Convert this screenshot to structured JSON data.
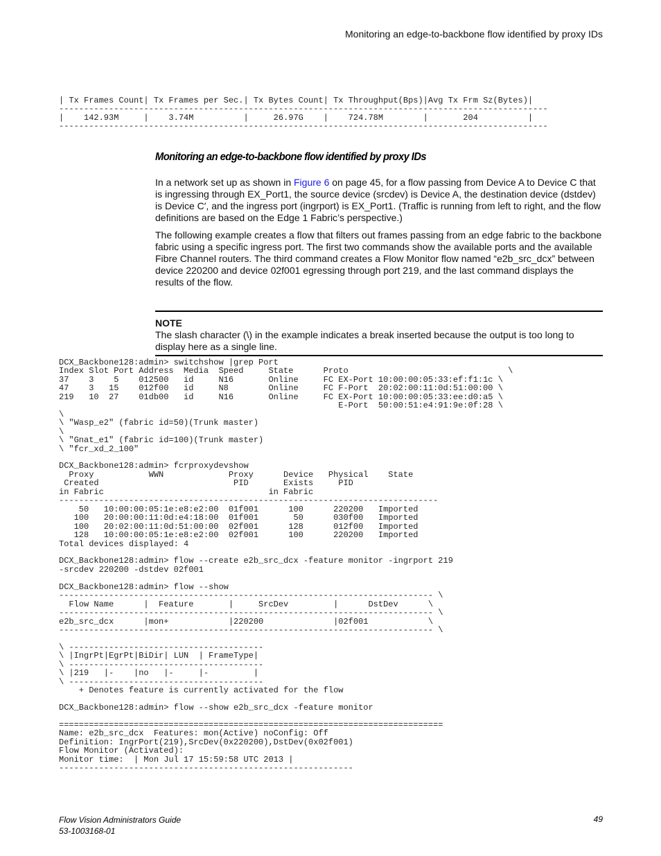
{
  "header": {
    "running_title": "Monitoring an edge-to-backbone flow identified by proxy IDs"
  },
  "stats_output": {
    "lines": [
      "| Tx Frames Count| Tx Frames per Sec.| Tx Bytes Count| Tx Throughput(Bps)|Avg Tx Frm Sz(Bytes)|",
      "--------------------------------------------------------------------------------------------------",
      "|    142.93M     |    3.74M          |     26.97G    |    724.78M        |       204          |",
      "--------------------------------------------------------------------------------------------------"
    ]
  },
  "section": {
    "heading": "Monitoring an edge-to-backbone flow identified by proxy IDs",
    "para1": {
      "before_link": "In a network set up as shown in ",
      "link_text": "Figure 6",
      "after_link": " on page 45, for a flow passing from Device A to Device C that is ingressing through EX_Port1, the source device (srcdev) is Device A, the destination device (dstdev) is Device C′, and the ingress port (ingrport) is EX_Port1. (Traffic is running from left to right, and the flow definitions are based on the Edge 1 Fabric’s perspective.)"
    },
    "para2": "The following example creates a flow that filters out frames passing from an edge fabric to the backbone fabric using a specific ingress port. The first two commands show the available ports and the available Fibre Channel routers. The third command creates a Flow Monitor flow named “e2b_src_dcx” between device 220200 and device 02f001 egressing through port 219, and the last command displays the results of the flow."
  },
  "note": {
    "label": "NOTE",
    "text": "The slash character (\\) in the example indicates a break inserted because the output is too long to display here as a single line."
  },
  "cli_output": {
    "lines": [
      "DCX_Backbone128:admin> switchshow |grep Port",
      "Index Slot Port Address  Media  Speed     State      Proto                                \\",
      "37    3    5    012500   id     N16       Online     FC EX-Port 10:00:00:05:33:ef:f1:1c \\",
      "47    3   15    012f00   id     N8        Online     FC F-Port  20:02:00:11:0d:51:00:00 \\",
      "219   10  27    01db00   id     N16       Online     FC EX-Port 10:00:00:05:33:ee:d0:a5 \\",
      "                                                        E-Port  50:00:51:e4:91:9e:0f:28 \\",
      "\\",
      "\\ \"Wasp_e2\" (fabric id=50)(Trunk master)",
      "\\",
      "\\ \"Gnat_e1\" (fabric id=100)(Trunk master)",
      "\\ \"fcr_xd_2_100\"",
      "",
      "DCX_Backbone128:admin> fcrproxydevshow",
      "  Proxy           WWN             Proxy      Device   Physical    State",
      " Created                           PID       Exists     PID",
      "in Fabric                                 in Fabric",
      "----------------------------------------------------------------------------",
      "    50   10:00:00:05:1e:e8:e2:00  01f001      100      220200   Imported",
      "   100   20:00:00:11:0d:e4:18:00  01f001       50      030f00   Imported",
      "   100   20:02:00:11:0d:51:00:00  02f001      128      012f00   Imported",
      "   128   10:00:00:05:1e:e8:e2:00  02f001      100      220200   Imported",
      "Total devices displayed: 4",
      "",
      "DCX_Backbone128:admin> flow --create e2b_src_dcx -feature monitor -ingrport 219",
      "-srcdev 220200 -dstdev 02f001",
      "",
      "DCX_Backbone128:admin> flow --show",
      "--------------------------------------------------------------------------- \\",
      "  Flow Name      |  Feature       |     SrcDev         |      DstDev      \\",
      "--------------------------------------------------------------------------- \\",
      "e2b_src_dcx      |mon+            |220200              |02f001            \\",
      "--------------------------------------------------------------------------- \\",
      "",
      "\\ ---------------------------------------",
      "\\ |IngrPt|EgrPt|BiDir| LUN  | FrameType|",
      "\\ ---------------------------------------",
      "\\ |219   |-    |no   |-     |-         |",
      "\\ ---------------------------------------",
      "    + Denotes feature is currently activated for the flow",
      "",
      "DCX_Backbone128:admin> flow --show e2b_src_dcx -feature monitor",
      "",
      "=============================================================================",
      "Name: e2b_src_dcx  Features: mon(Active) noConfig: Off",
      "Definition: IngrPort(219),SrcDev(0x220200),DstDev(0x02f001)",
      "Flow Monitor (Activated):",
      "Monitor time:  | Mon Jul 17 15:59:58 UTC 2013 |",
      "-----------------------------------------------------------"
    ]
  },
  "footer": {
    "doc_title": "Flow Vision Administrators Guide",
    "doc_number": "53-1003168-01",
    "page_number": "49"
  }
}
